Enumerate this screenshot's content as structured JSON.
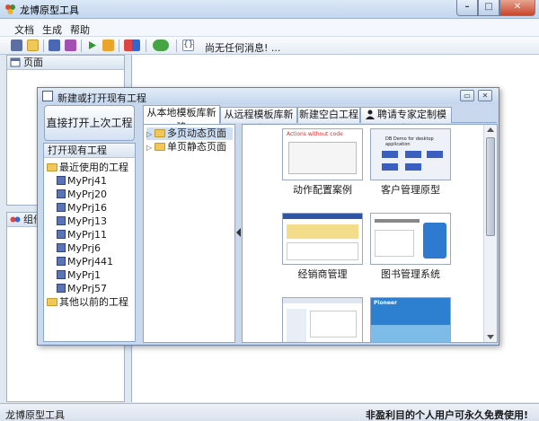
{
  "window": {
    "title": "龙博原型工具",
    "icon": "app-logo-icon"
  },
  "menu": {
    "items": [
      "文档",
      "生成",
      "帮助"
    ]
  },
  "toolbar": {
    "icons": [
      "properties-icon",
      "open-folder-icon",
      "save-icon",
      "save-as-icon",
      "run-icon",
      "archive-icon",
      "component-menu-icon",
      "plugin-menu-icon",
      "info-icon"
    ],
    "message": "尚无任何消息! ..."
  },
  "panels": {
    "page": {
      "title": "页面"
    },
    "component": {
      "title": "组件"
    }
  },
  "status": {
    "left": "龙博原型工具",
    "right": "非盈利目的个人用户可永久免费使用!"
  },
  "dialog": {
    "title": "新建或打开现有工程",
    "open_last": "直接打开上次工程",
    "open_existing": {
      "title": "打开现有工程",
      "recent_group": "最近使用的工程",
      "projects": [
        "MyPrj41",
        "MyPrj20",
        "MyPrj16",
        "MyPrj13",
        "MyPrj11",
        "MyPrj6",
        "MyPrj441",
        "MyPrj1",
        "MyPrj57"
      ],
      "older_group": "其他以前的工程"
    },
    "tabs": [
      "从本地模板库新建",
      "从远程模板库新建",
      "新建空白工程",
      "聘请专家定制模板"
    ],
    "template_tree": [
      "多页动态页面",
      "单页静态页面"
    ],
    "templates": [
      {
        "label": "动作配置案例",
        "thumb_text": "Actions without code"
      },
      {
        "label": "客户管理原型",
        "thumb_text": "DB Demo for desktop application"
      },
      {
        "label": "经销商管理",
        "thumb_text": ""
      },
      {
        "label": "图书管理系统",
        "thumb_text": ""
      },
      {
        "label": "",
        "thumb_text": ""
      },
      {
        "label": "",
        "thumb_text": "Pioneer"
      }
    ]
  }
}
